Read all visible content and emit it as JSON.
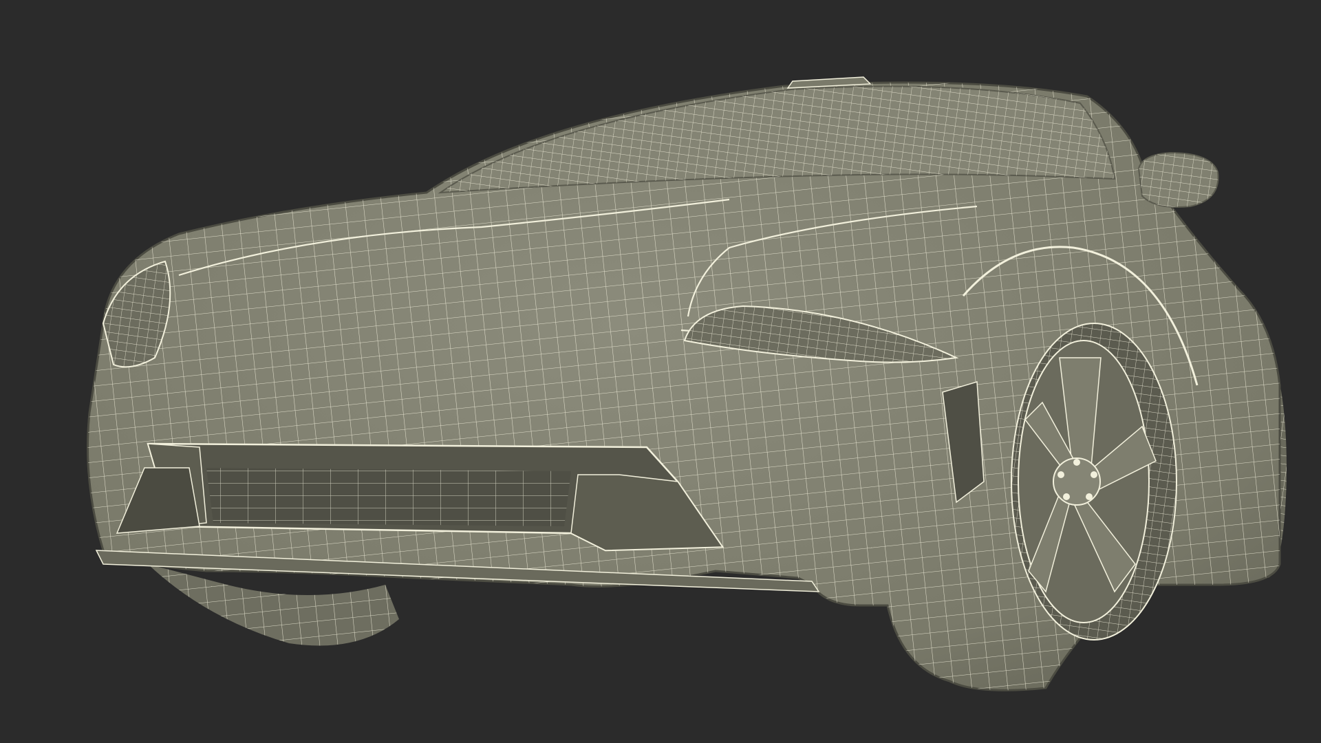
{
  "scene": {
    "subject": "sports-car-wireframe-render",
    "view": "front-three-quarter-low-angle"
  },
  "colors": {
    "background": "#2b2b2b",
    "surface": "#7b7b6b",
    "surface_light": "#8a8a7a",
    "surface_dark": "#5f5f52",
    "shadow": "#4c4c42",
    "wire": "#f2f0dc"
  }
}
